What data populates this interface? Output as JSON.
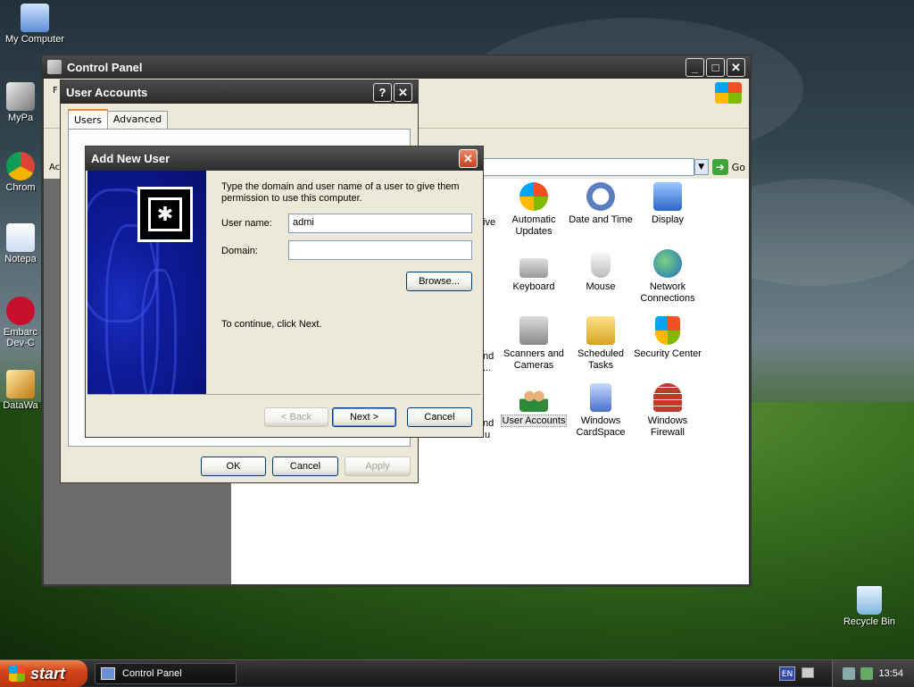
{
  "desktop": {
    "icons": [
      {
        "label": "My Computer"
      },
      {
        "label": "MyPa"
      },
      {
        "label": "Chrom"
      },
      {
        "label": "Notepa"
      },
      {
        "label": "Embarc"
      },
      {
        "label": "Dev-C"
      },
      {
        "label": "DataWa"
      },
      {
        "label": "Recycle Bin"
      }
    ]
  },
  "control_panel": {
    "title": "Control Panel",
    "go_label": "Go",
    "menu_fragment": "F",
    "addr_fragment": "Ac",
    "items": [
      {
        "label": "Automatic Updates",
        "icon": "automatic-updates-icon"
      },
      {
        "label": "Date and Time",
        "icon": "date-time-icon"
      },
      {
        "label": "Display",
        "icon": "display-icon"
      },
      {
        "label": "Keyboard",
        "icon": "keyboard-icon"
      },
      {
        "label": "Mouse",
        "icon": "mouse-icon"
      },
      {
        "label": "Network Connections",
        "icon": "network-connections-icon"
      },
      {
        "label": "Scanners and Cameras",
        "icon": "scanners-cameras-icon"
      },
      {
        "label": "Scheduled Tasks",
        "icon": "scheduled-tasks-icon"
      },
      {
        "label": "Security Center",
        "icon": "security-center-icon"
      },
      {
        "label": "User Accounts",
        "icon": "user-accounts-icon"
      },
      {
        "label": "Windows CardSpace",
        "icon": "cardspace-icon"
      },
      {
        "label": "Windows Firewall",
        "icon": "firewall-icon"
      }
    ],
    "cut_labels": [
      "ive",
      "nd",
      "nd",
      "...",
      "u"
    ]
  },
  "user_accounts": {
    "title": "User Accounts",
    "help_label": "?",
    "tabs": [
      {
        "label": "Users"
      },
      {
        "label": "Advanced"
      }
    ],
    "buttons": {
      "ok": "OK",
      "cancel": "Cancel",
      "apply": "Apply"
    }
  },
  "add_new_user": {
    "title": "Add New User",
    "description": "Type the domain and user name of a user to give them permission to use this computer.",
    "username_label": "User name:",
    "username_value": "admi",
    "domain_label": "Domain:",
    "domain_value": "",
    "browse_label": "Browse...",
    "continue_text": "To continue, click Next.",
    "back_label": "< Back",
    "next_label": "Next >",
    "cancel_label": "Cancel"
  },
  "taskbar": {
    "start_label": "start",
    "task_label": "Control Panel",
    "lang": "EN",
    "clock": "13:54"
  }
}
